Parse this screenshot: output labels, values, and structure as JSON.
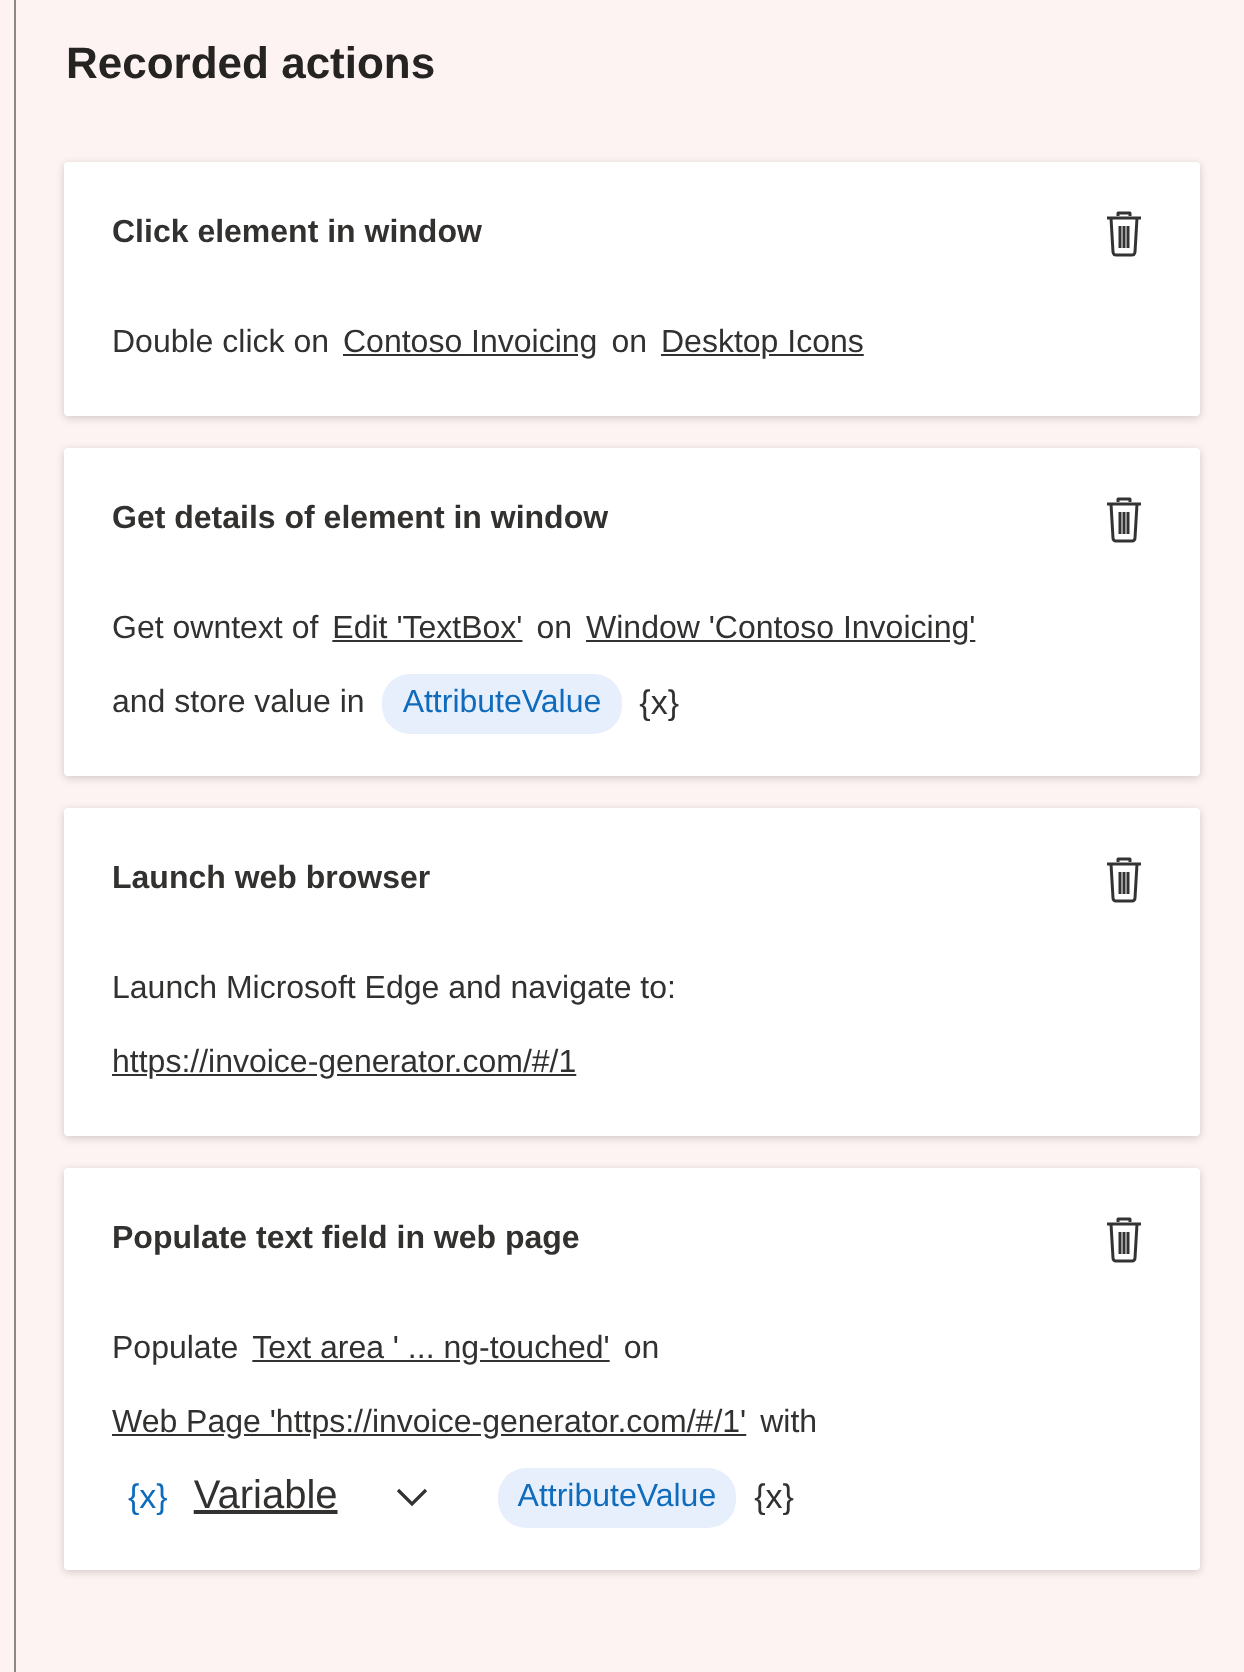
{
  "heading": "Recorded actions",
  "actions": [
    {
      "title": "Click element in window",
      "lines": [
        [
          {
            "kind": "text",
            "text": "Double click on"
          },
          {
            "kind": "link",
            "text": "Contoso Invoicing"
          },
          {
            "kind": "text",
            "text": "on"
          },
          {
            "kind": "link",
            "text": "Desktop Icons"
          }
        ]
      ]
    },
    {
      "title": "Get details of element in window",
      "lines": [
        [
          {
            "kind": "text",
            "text": "Get owntext of"
          },
          {
            "kind": "link",
            "text": "Edit 'TextBox'"
          },
          {
            "kind": "text",
            "text": "on"
          },
          {
            "kind": "link",
            "text": "Window 'Contoso Invoicing'"
          }
        ],
        [
          {
            "kind": "text",
            "text": "and store value in"
          },
          {
            "kind": "token",
            "text": "AttributeValue"
          },
          {
            "kind": "var",
            "text": "{x}"
          }
        ]
      ]
    },
    {
      "title": "Launch web browser",
      "lines": [
        [
          {
            "kind": "text",
            "text": "Launch Microsoft Edge and navigate to:"
          }
        ],
        [
          {
            "kind": "link",
            "text": "https://invoice-generator.com/#/1"
          }
        ]
      ]
    },
    {
      "title": "Populate text field in web page",
      "lines": [
        [
          {
            "kind": "text",
            "text": "Populate"
          },
          {
            "kind": "link",
            "text": "Text area ' ...  ng-touched'"
          },
          {
            "kind": "text",
            "text": "on"
          }
        ],
        [
          {
            "kind": "link",
            "text": "Web Page 'https://invoice-generator.com/#/1'"
          },
          {
            "kind": "text",
            "text": "with"
          }
        ],
        [
          {
            "kind": "dropdown",
            "icon": "{x}",
            "text": "Variable"
          },
          {
            "kind": "token",
            "text": "AttributeValue"
          },
          {
            "kind": "var",
            "text": "{x}"
          }
        ]
      ]
    }
  ]
}
